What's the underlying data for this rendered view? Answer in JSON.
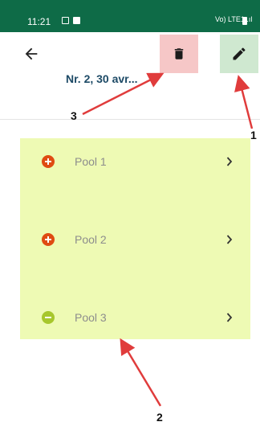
{
  "status_bar": {
    "time": "11:21",
    "signal": "Vo) LTE1 .ıl",
    "colors": {
      "bar": "#0e6b47"
    }
  },
  "header": {
    "back_icon": "arrow-left-icon",
    "title": "Nr. 2, 30 avr...",
    "delete_icon": "trash-icon",
    "edit_icon": "pencil-icon"
  },
  "pools": [
    {
      "label": "Pool 1",
      "status_icon": "plus-circle-icon",
      "status_color": "#df4b12"
    },
    {
      "label": "Pool 2",
      "status_icon": "plus-circle-icon",
      "status_color": "#df4b12"
    },
    {
      "label": "Pool 3",
      "status_icon": "minus-circle-icon",
      "status_color": "#a7c72c"
    }
  ],
  "annotations": {
    "one": "1",
    "two": "2",
    "three": "3",
    "color": "#e03c3c"
  }
}
